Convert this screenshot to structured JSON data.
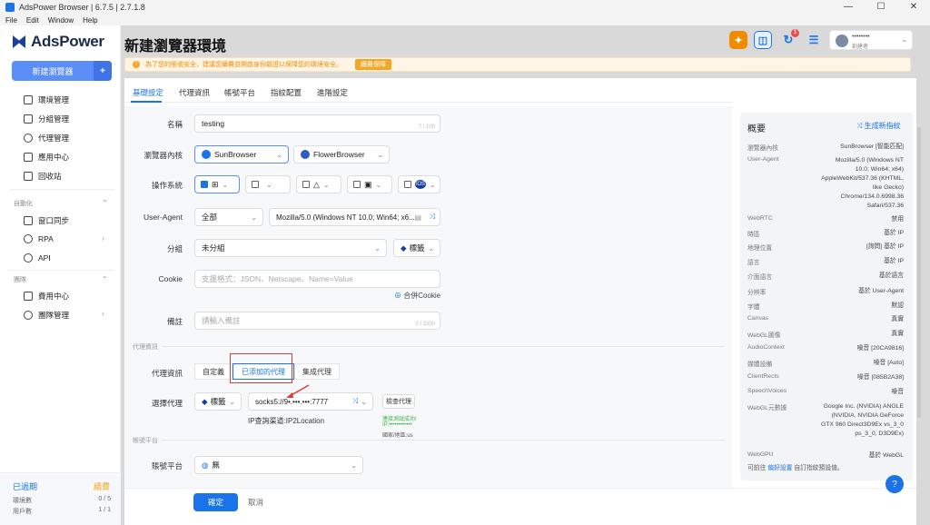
{
  "window": {
    "title": "AdsPower Browser | 6.7.5 | 2.7.1.8",
    "menu": [
      "File",
      "Edit",
      "Window",
      "Help"
    ],
    "controls": [
      "—",
      "☐",
      "✕"
    ]
  },
  "sidebar": {
    "brand": "AdsPower",
    "new_button": "新建瀏覽器",
    "items_main": [
      "環境管理",
      "分組管理",
      "代理管理",
      "應用中心",
      "回收站"
    ],
    "automation_header": "自動化",
    "items_auto": [
      "窗口同步",
      "RPA",
      "API"
    ],
    "team_header": "團隊",
    "items_team": [
      "費用中心",
      "團隊管理"
    ],
    "expiry": {
      "status": "已過期",
      "renew": "續費",
      "env_label": "環境數",
      "env_value": "0 / 5",
      "user_label": "用戶數",
      "user_value": "1 / 1"
    }
  },
  "header": {
    "title": "新建瀏覽器環境",
    "user_name": "••••••••",
    "user_role": "創建者",
    "badge_count": "1"
  },
  "notice": {
    "text": "為了您的賬號安全，建議您續費並開啟身份驗證以保障您的環境安全。",
    "button": "續費保障"
  },
  "tabs": [
    "基礎設定",
    "代理資訊",
    "帳號平台",
    "指紋配置",
    "進階設定"
  ],
  "form": {
    "name_label": "名稱",
    "name_value": "testing",
    "name_count": "7 / 100",
    "kernel_label": "瀏覽器內核",
    "kernel_options": [
      "SunBrowser",
      "FlowerBrowser"
    ],
    "os_label": "操作系統",
    "os_options": [
      "⊞",
      "",
      "△",
      "▣",
      "iOS"
    ],
    "ua_label": "User-Agent",
    "ua_select": "全部",
    "ua_value": "Mozilla/5.0 (Windows NT 10.0; Win64; x6...",
    "group_label": "分組",
    "group_value": "未分組",
    "tag_label": "標籤",
    "cookie_label": "Cookie",
    "cookie_placeholder": "支援格式：JSON、Netscape、Name=Value",
    "cookie_merge": "合併Cookie",
    "note_label": "備註",
    "note_placeholder": "請輸入備註",
    "note_count": "0 / 1500",
    "proxy_section": "代理資訊",
    "proxy_label": "代理資訊",
    "proxy_modes": [
      "自定義",
      "已添加的代理",
      "集成代理"
    ],
    "select_proxy_label": "選擇代理",
    "proxy_tag": "標籤",
    "proxy_value": "socks5://9•.•••.•••:7777",
    "check_proxy": "檢查代理",
    "ip_channel": "IP查詢渠道:IP2Location",
    "check_ok": "連接測試成功!",
    "check_ip": "IP:••••••••••••",
    "check_country": "國家/地區:us",
    "platform_section": "帳號平台",
    "platform_label": "賬號平台",
    "platform_value": "無"
  },
  "footer": {
    "ok": "確定",
    "cancel": "取消"
  },
  "summary": {
    "title": "概要",
    "generate": "生成新指紋",
    "rows": [
      {
        "k": "瀏覽器內核",
        "v": "SunBrowser [智能匹配]"
      },
      {
        "k": "User-Agent",
        "v": "Mozilla/5.0 (Windows NT 10.0; Win64; x64) AppleWebKit/537.36 (KHTML, like Gecko) Chrome/134.0.6998.36 Safari/537.36"
      },
      {
        "k": "WebRTC",
        "v": "禁用"
      },
      {
        "k": "時區",
        "v": "基於 IP"
      },
      {
        "k": "地理位置",
        "v": "[詢問] 基於 IP"
      },
      {
        "k": "語言",
        "v": "基於 IP"
      },
      {
        "k": "介面語言",
        "v": "基於語言"
      },
      {
        "k": "分辨率",
        "v": "基於 User-Agent"
      },
      {
        "k": "字體",
        "v": "默認"
      },
      {
        "k": "Canvas",
        "v": "真實"
      },
      {
        "k": "WebGL圖像",
        "v": "真實"
      },
      {
        "k": "AudioContext",
        "v": "噪音 [20CA9816]"
      },
      {
        "k": "媒體設備",
        "v": "噪音 [Auto]"
      },
      {
        "k": "ClientRects",
        "v": "噪音 [085B2A38]"
      },
      {
        "k": "SpeechVoices",
        "v": "噪音"
      },
      {
        "k": "WebGL元數據",
        "v": "Google Inc. (NVIDIA) ANGLE (NVIDIA, NVIDIA GeForce GTX 960 Direct3D9Ex vs_3_0 ps_3_0, D3D9Ex)"
      },
      {
        "k": "WebGPU",
        "v": "基於 WebGL"
      }
    ],
    "footer_prefix": "可前往",
    "footer_link": "偏好設置",
    "footer_suffix": "自訂指紋預設值。"
  },
  "colors": {
    "accent": "#1a73e8",
    "warning": "#f5a623",
    "sidebar_button": "#5b8ef6"
  }
}
